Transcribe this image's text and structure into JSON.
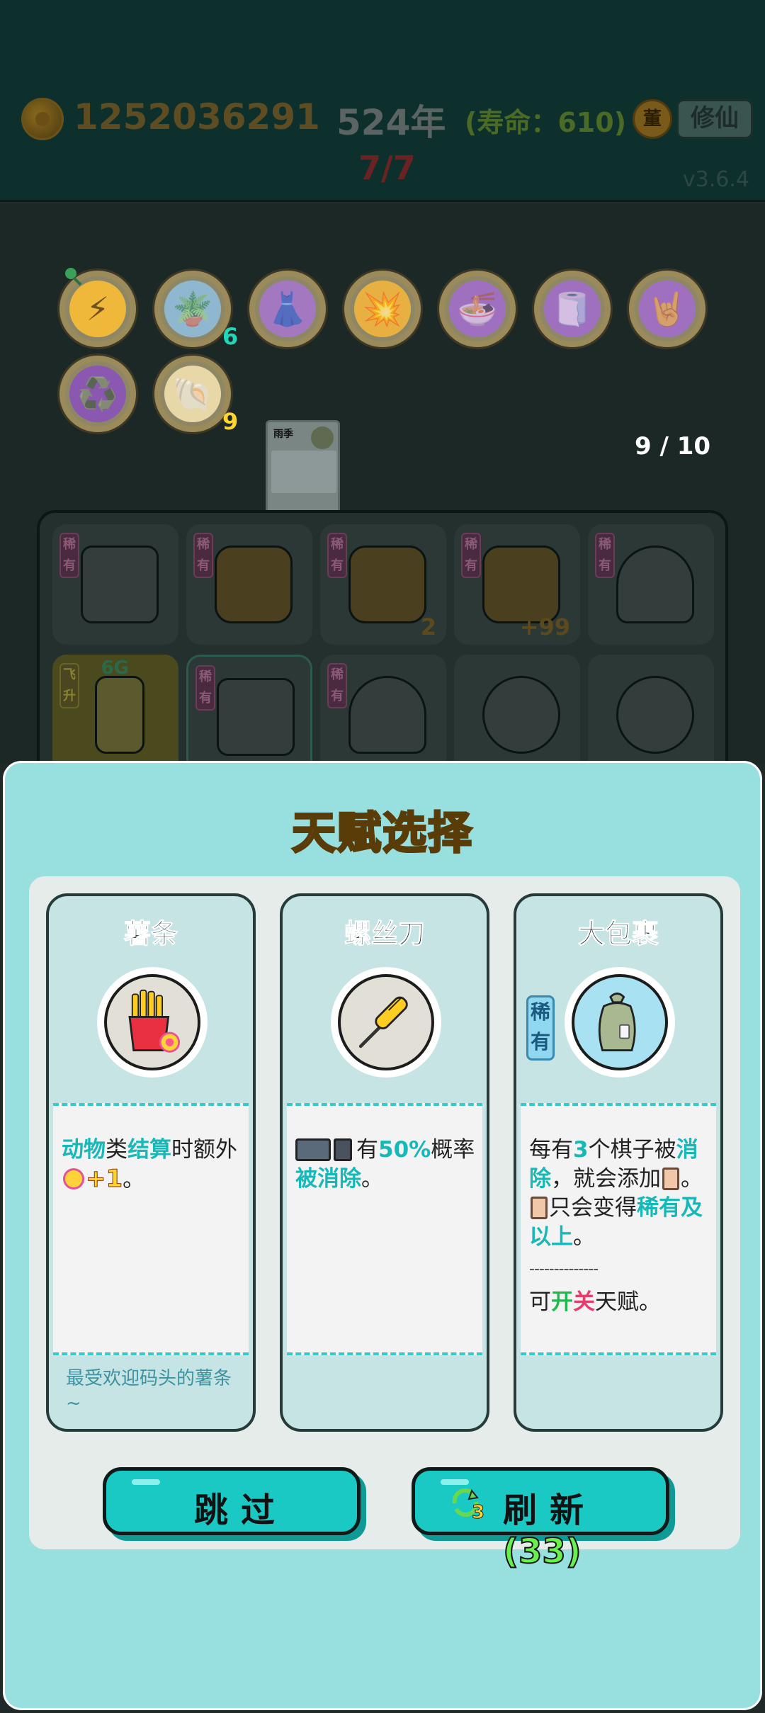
{
  "hud": {
    "coins": "1252036291",
    "year": "524年",
    "lifespan": "(寿命：610)",
    "progress": "7/7",
    "version": "v3.6.4",
    "coin_badge": "董",
    "cultivate_button": "修仙"
  },
  "talents": [
    {
      "name": "lightning",
      "emoji": "⚡",
      "bg": "#f0b83a",
      "count": ""
    },
    {
      "name": "flower-pot",
      "emoji": "🪴",
      "bg": "#8fb8d0",
      "count": "6"
    },
    {
      "name": "skirt",
      "emoji": "👗",
      "bg": "#a478c0",
      "count": ""
    },
    {
      "name": "mushroom-cloud",
      "emoji": "💥",
      "bg": "#e8b040",
      "count": ""
    },
    {
      "name": "fishbowls",
      "emoji": "🍜",
      "bg": "#a070c0",
      "count": ""
    },
    {
      "name": "tissue-box",
      "emoji": "🧻",
      "bg": "#a070c0",
      "count": ""
    },
    {
      "name": "rock-hand",
      "emoji": "🤘",
      "bg": "#a070c0",
      "count": ""
    },
    {
      "name": "recycle",
      "emoji": "♻️",
      "bg": "#8a58b0",
      "count": ""
    },
    {
      "name": "shell",
      "emoji": "🐚",
      "bg": "#e8d8a8",
      "count": "9"
    }
  ],
  "mini_card_title": "雨季",
  "piece_counter": "9 / 10",
  "board": {
    "tag_rare": "稀有",
    "tag_fly": "飞升",
    "tile_counts": [
      "2",
      "+99"
    ],
    "tile_badge": "6G"
  },
  "modal": {
    "title": "天赋选择",
    "cards": [
      {
        "name": "薯条",
        "icon": "fries-icon",
        "desc_parts": [
          "动物",
          "类",
          "结算",
          "时额外",
          "+1",
          "。"
        ],
        "flavor": "最受欢迎码头的薯条~"
      },
      {
        "name": "螺丝刀",
        "icon": "screwdriver-icon",
        "desc_parts": [
          "有",
          "50%",
          "概率",
          "被消除",
          "。"
        ]
      },
      {
        "name": "大包裹",
        "icon": "big-bag-icon",
        "rarity": "稀有",
        "desc_parts": [
          "每有",
          "3",
          "个棋子被",
          "消除",
          "，就会添加",
          "。",
          "只会变得",
          "稀有及以上",
          "。"
        ],
        "separator": "--------------",
        "toggle_parts": [
          "可",
          "开",
          "关",
          "天赋。"
        ]
      }
    ],
    "skip_button": "跳过",
    "refresh_button": "刷新",
    "refresh_count": "(33)",
    "refresh_badge": "3"
  }
}
